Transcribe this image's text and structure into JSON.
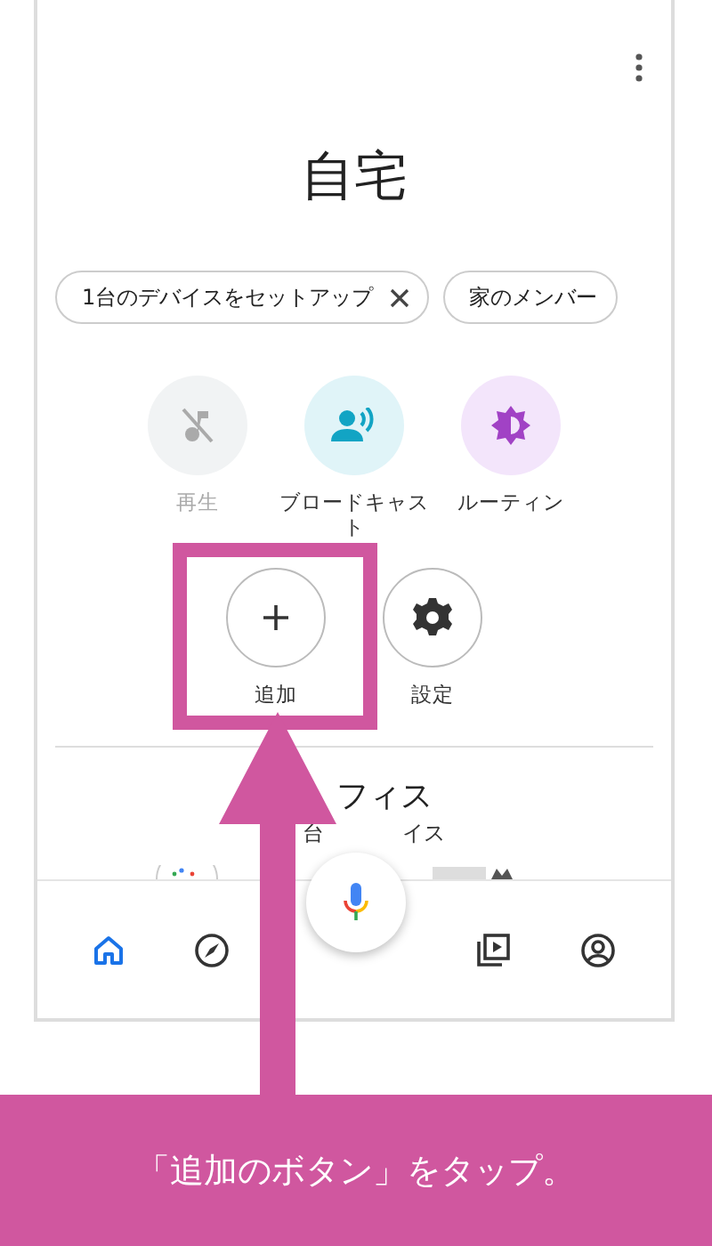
{
  "title": "自宅",
  "chips": [
    {
      "label": "1台のデバイスをセットアップ",
      "closable": true
    },
    {
      "label": "家のメンバー",
      "closable": false
    }
  ],
  "actions": [
    {
      "kind": "play",
      "label": "再生",
      "disabled": true
    },
    {
      "kind": "broadcast",
      "label": "ブロードキャスト",
      "disabled": false
    },
    {
      "kind": "routine",
      "label": "ルーティン",
      "disabled": false
    },
    {
      "kind": "add",
      "label": "追加",
      "disabled": false
    },
    {
      "kind": "settings",
      "label": "設定",
      "disabled": false
    }
  ],
  "room": {
    "title": "フィス",
    "subtitle_parts": [
      "台",
      "イス"
    ]
  },
  "nav": [
    {
      "kind": "home",
      "selected": true
    },
    {
      "kind": "explore",
      "selected": false
    },
    {
      "kind": "media",
      "selected": false
    },
    {
      "kind": "account",
      "selected": false
    }
  ],
  "callout": {
    "text": "「追加のボタン」をタップ。"
  }
}
